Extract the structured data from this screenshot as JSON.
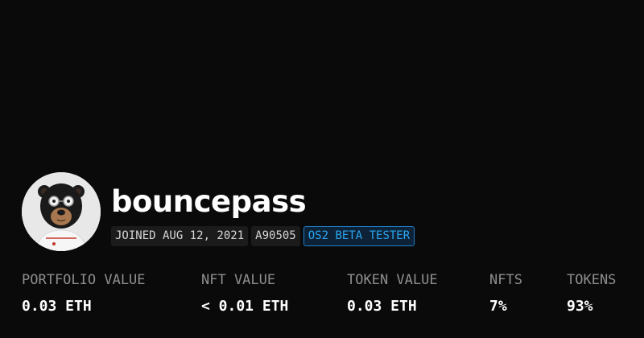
{
  "profile": {
    "username": "bouncepass",
    "avatar_icon": "bear-avatar-icon",
    "badges": {
      "joined": "JOINED AUG 12, 2021",
      "id": "A90505",
      "beta": "OS2 BETA TESTER"
    }
  },
  "stats": [
    {
      "label": "PORTFOLIO VALUE",
      "value": "0.03 ETH"
    },
    {
      "label": "NFT VALUE",
      "value": "< 0.01 ETH"
    },
    {
      "label": "TOKEN VALUE",
      "value": "0.03 ETH"
    },
    {
      "label": "NFTS",
      "value": "7%"
    },
    {
      "label": "TOKENS",
      "value": "93%"
    }
  ],
  "colors": {
    "background": "#0a0a0a",
    "text": "#ffffff",
    "muted": "#8e8e8e",
    "accent": "#2ba6f0"
  }
}
